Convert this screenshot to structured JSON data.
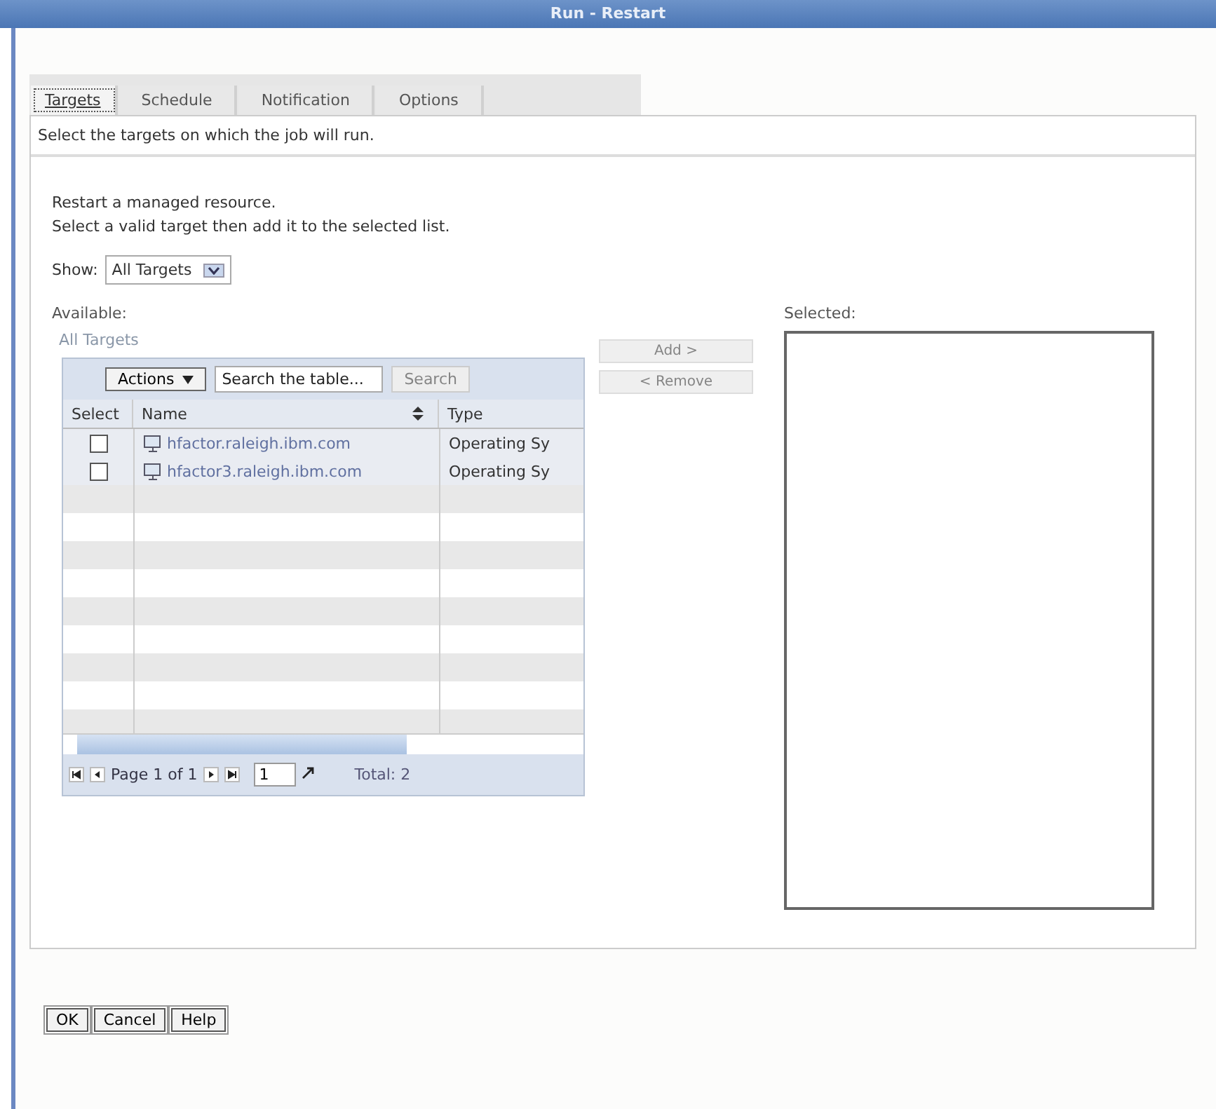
{
  "window": {
    "title": "Run - Restart"
  },
  "tabs": [
    {
      "label": "Targets",
      "selected": true
    },
    {
      "label": "Schedule",
      "selected": false
    },
    {
      "label": "Notification",
      "selected": false
    },
    {
      "label": "Options",
      "selected": false
    }
  ],
  "instruction": "Select the targets on which the job will run.",
  "description": [
    "Restart a managed resource.",
    "Select a valid target then add it to the selected list."
  ],
  "show": {
    "label": "Show:",
    "value": "All Targets"
  },
  "available": {
    "label": "Available:",
    "caption": "All Targets"
  },
  "toolbar": {
    "actions": "Actions",
    "search_placeholder": "Search the table...",
    "search_button": {
      "label": "Search",
      "disabled": true
    }
  },
  "table": {
    "columns": [
      "Select",
      "Name",
      "Type"
    ],
    "rows": [
      {
        "checked": false,
        "name": "hfactor.raleigh.ibm.com",
        "type": "Operating Sy"
      },
      {
        "checked": false,
        "name": "hfactor3.raleigh.ibm.com",
        "type": "Operating Sy"
      }
    ]
  },
  "pager": {
    "page": "Page 1 of 1",
    "page_input": "1",
    "total": "Total: 2"
  },
  "move_buttons": [
    {
      "label": "Add >",
      "disabled": true
    },
    {
      "label": "< Remove",
      "disabled": true
    }
  ],
  "selected": {
    "label": "Selected:"
  },
  "buttons": [
    "OK",
    "Cancel",
    "Help"
  ]
}
